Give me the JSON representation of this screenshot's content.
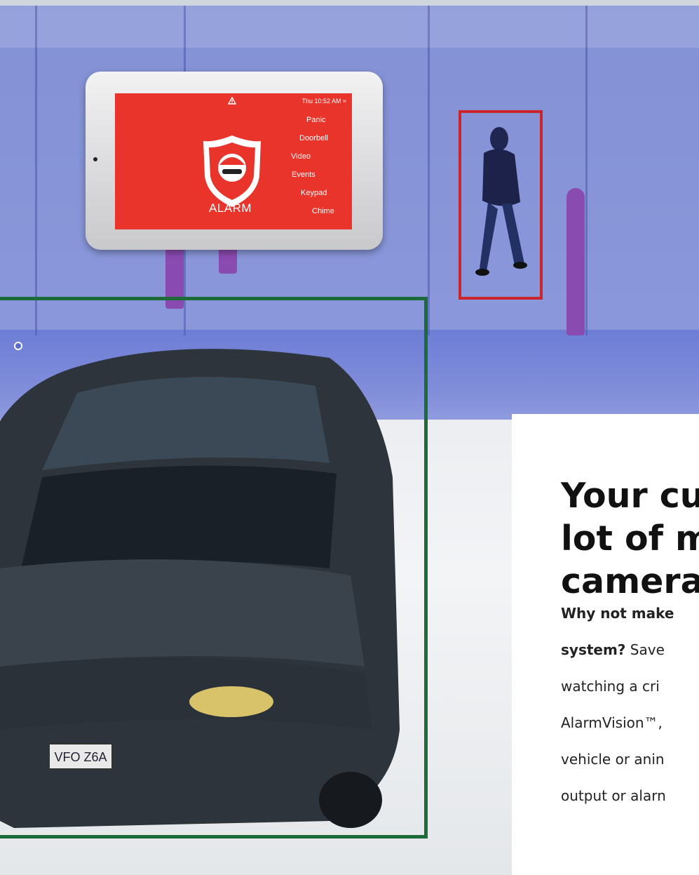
{
  "tablet": {
    "time": "Thu 10:52 AM",
    "brand_label": "ALARM",
    "menu": [
      "Panic",
      "Doorbell",
      "Video",
      "Events",
      "Keypad",
      "Chime"
    ]
  },
  "vehicle": {
    "license_plate": "VFO Z6A"
  },
  "headline": {
    "lines": [
      "Your cu",
      "lot of m",
      "camera"
    ]
  },
  "body": {
    "lines": [
      {
        "bold": "Why not make",
        "text": ""
      },
      {
        "bold": "system?",
        "text": " Save"
      },
      {
        "bold": "",
        "text": "watching a cri"
      },
      {
        "bold": "",
        "text": "AlarmVision™,"
      },
      {
        "bold": "",
        "text": "vehicle or anin"
      },
      {
        "bold": "",
        "text": "output or alarn"
      }
    ]
  },
  "colors": {
    "wall_overlay": "#4a5acd",
    "tablet_screen": "#e8342a",
    "person_box": "#c9262c",
    "vehicle_box": "#1e6b3a",
    "bollard": "#8a4bb0"
  },
  "icons": [
    "warning-icon",
    "wifi-icon",
    "alarm-shield-logo"
  ]
}
